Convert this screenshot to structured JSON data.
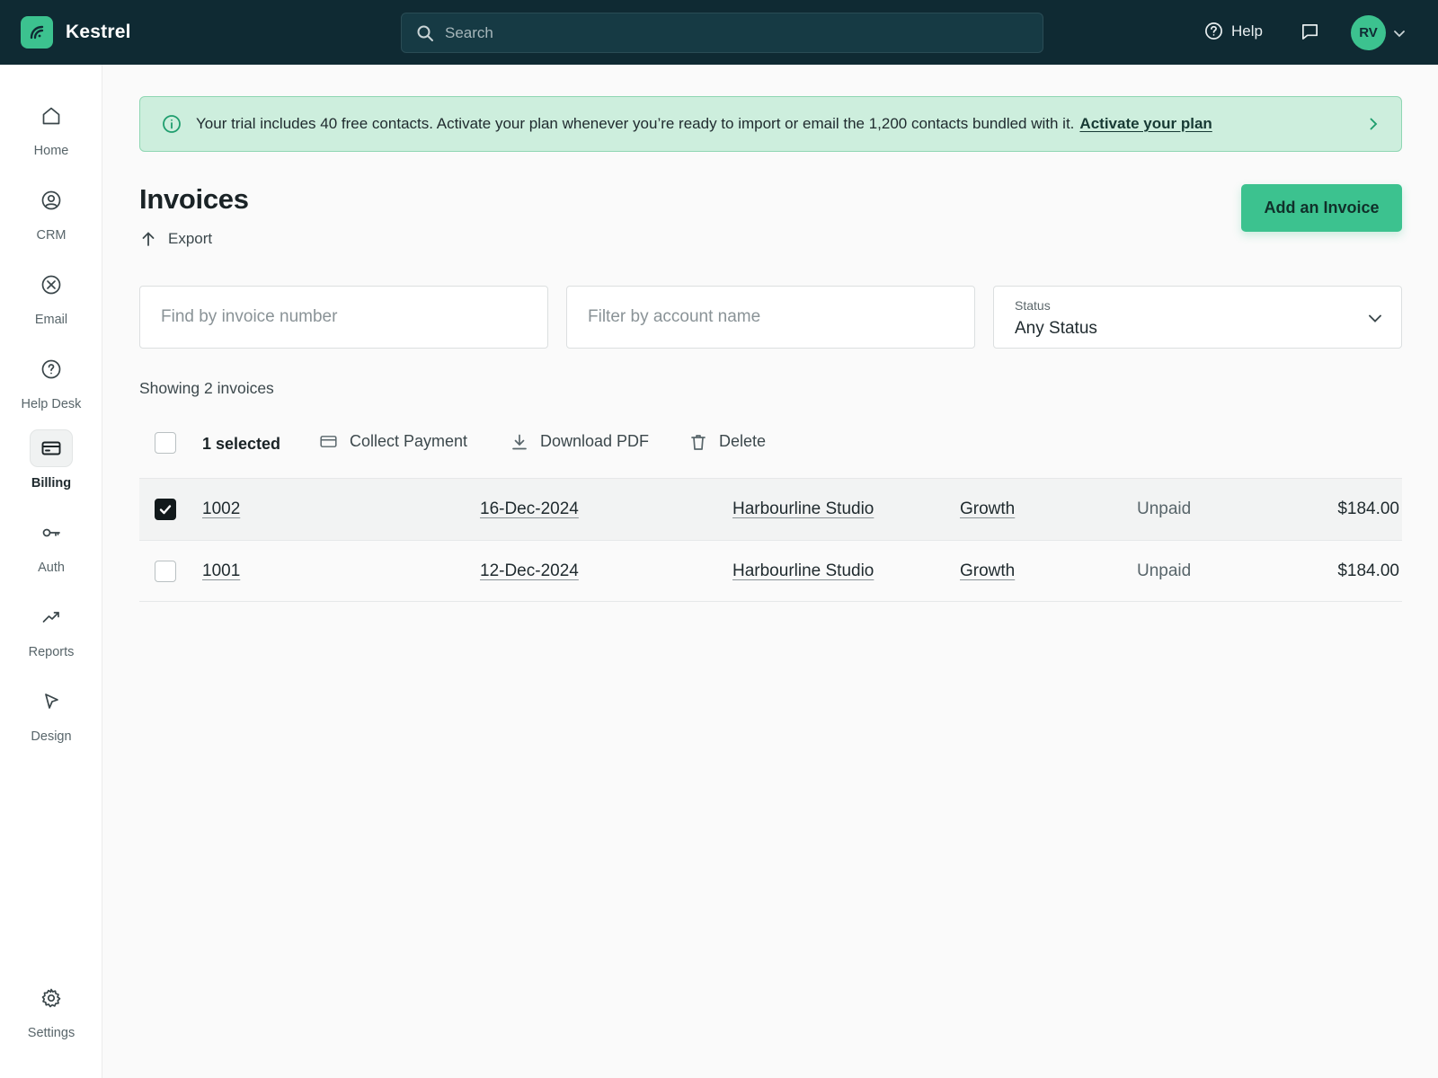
{
  "app": {
    "name": "Kestrel"
  },
  "topbar": {
    "search_placeholder": "Search",
    "help_label": "Help",
    "avatar_initials": "RV"
  },
  "sidebar": {
    "items": [
      {
        "label": "Home",
        "icon": "home-icon"
      },
      {
        "label": "CRM",
        "icon": "user-circle-icon"
      },
      {
        "label": "Email",
        "icon": "email-icon"
      },
      {
        "label": "Help Desk",
        "icon": "help-desk-icon"
      },
      {
        "label": "Billing",
        "icon": "credit-card-icon",
        "active": true
      },
      {
        "label": "Auth",
        "icon": "key-icon"
      },
      {
        "label": "Reports",
        "icon": "trend-icon"
      },
      {
        "label": "Design",
        "icon": "cursor-icon"
      }
    ],
    "settings_label": "Settings"
  },
  "banner": {
    "text": "Your trial includes 40 free contacts. Activate your plan whenever you’re ready to import or email the 1,200 contacts bundled with it.",
    "link_text": "Activate your plan"
  },
  "page": {
    "title": "Invoices",
    "export_label": "Export",
    "add_button": "Add an Invoice"
  },
  "filters": {
    "invoice_placeholder": "Find by invoice number",
    "account_placeholder": "Filter by account name",
    "status_label": "Status",
    "status_value": "Any Status"
  },
  "summary": {
    "showing_text": "Showing 2 invoices"
  },
  "bulk_actions": {
    "selected_text": "1 selected",
    "collect_payment": "Collect Payment",
    "download_pdf": "Download PDF",
    "delete": "Delete"
  },
  "invoices": [
    {
      "number": "1002",
      "date": "16-Dec-2024",
      "account": "Harbourline Studio",
      "plan": "Growth",
      "status": "Unpaid",
      "amount": "$184.00",
      "selected": true
    },
    {
      "number": "1001",
      "date": "12-Dec-2024",
      "account": "Harbourline Studio",
      "plan": "Growth",
      "status": "Unpaid",
      "amount": "$184.00",
      "selected": false
    }
  ],
  "colors": {
    "topbar_bg": "#0f2a33",
    "accent": "#3cc28f",
    "banner_bg": "#cdeedd"
  }
}
